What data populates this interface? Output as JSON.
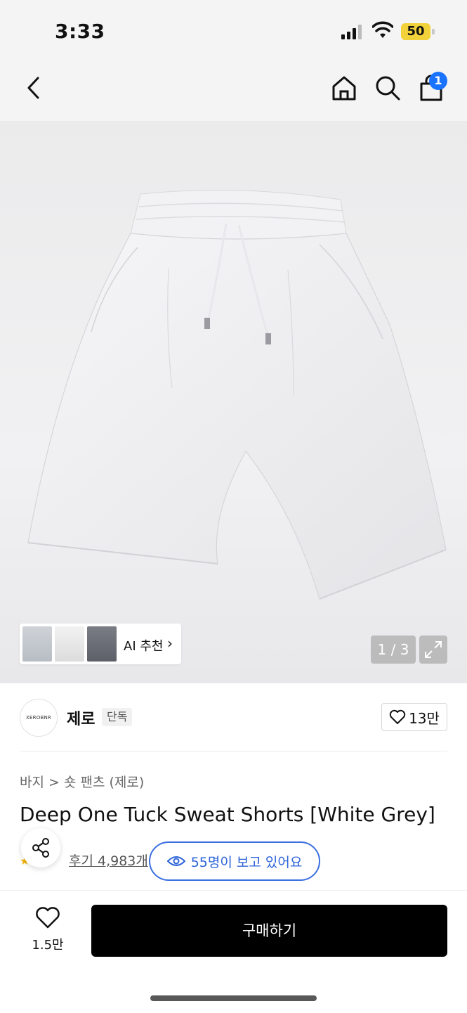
{
  "status_bar": {
    "time": "3:33",
    "battery": "50"
  },
  "header": {
    "cart_count": "1"
  },
  "gallery": {
    "pager": "1 / 3",
    "ai_label": "AI 추천"
  },
  "brand": {
    "logo_text": "XEROBNR",
    "name": "제로",
    "badge": "단독",
    "likes": "13만"
  },
  "product": {
    "breadcrumb": "바지 > 숏 팬츠 (제로)",
    "title": "Deep One Tuck Sweat Shorts [White Grey]",
    "reviews": "후기 4,983개",
    "viewers": "55명이 보고 있어요"
  },
  "bottom": {
    "wish_count": "1.5만",
    "buy_label": "구매하기"
  },
  "colors": {
    "accent_blue": "#2c63d8",
    "badge_blue": "#1a73ff",
    "battery_yellow": "#f2d23a"
  }
}
